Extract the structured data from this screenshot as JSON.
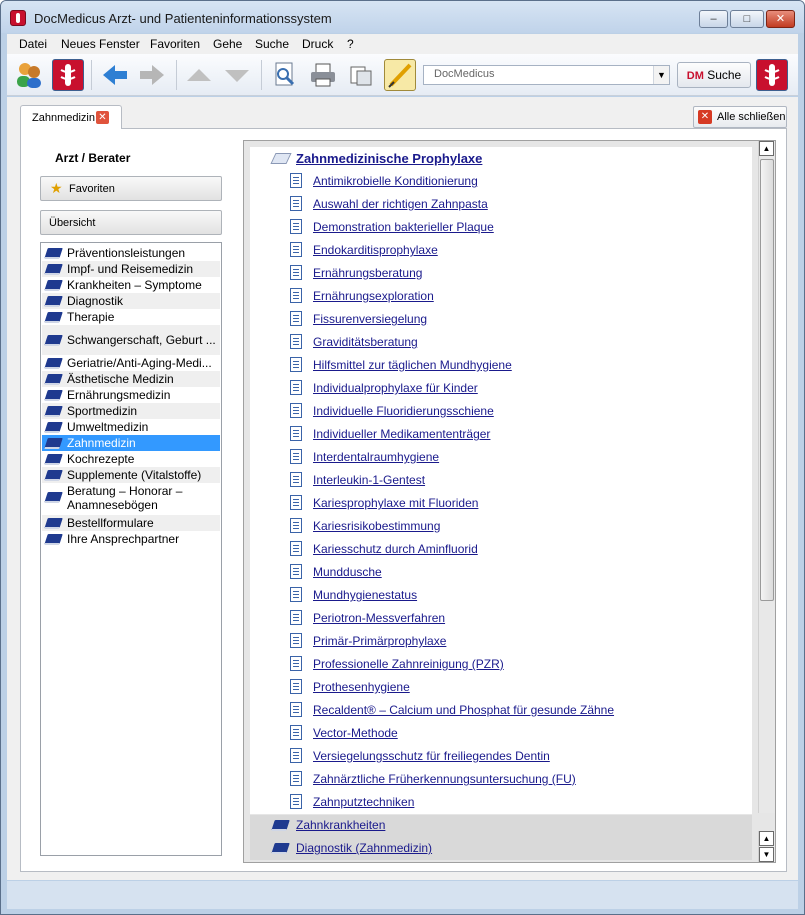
{
  "window": {
    "title": "DocMedicus Arzt- und Patienteninformationssystem"
  },
  "menu": [
    "Datei",
    "Neues Fenster",
    "Favoriten",
    "Gehe",
    "Suche",
    "Druck",
    "?"
  ],
  "toolbar": {
    "combo_value": "DocMedicus",
    "search_prefix": "DM",
    "search_label": "Suche"
  },
  "tabs": {
    "active": "Zahnmedizin",
    "close_all": "Alle schließen"
  },
  "left": {
    "heading": "Arzt / Berater",
    "favoriten": "Favoriten",
    "uebersicht": "Übersicht",
    "items": [
      "Präventionsleistungen",
      "Impf- und Reisemedizin",
      "Krankheiten – Symptome",
      "Diagnostik",
      "Therapie",
      "Schwangerschaft, Geburt ...",
      "Geriatrie/Anti-Aging-Medi...",
      "Ästhetische Medizin",
      "Ernährungsmedizin",
      "Sportmedizin",
      "Umweltmedizin",
      "Zahnmedizin",
      "Kochrezepte",
      "Supplemente (Vitalstoffe)",
      "Beratung – Honorar – Anamnesebögen",
      "Bestellformulare",
      "Ihre Ansprechpartner"
    ]
  },
  "content": {
    "section_title": "Zahnmedizinische Prophylaxe",
    "links": [
      "Antimikrobielle Konditionierung",
      "Auswahl der richtigen Zahnpasta",
      "Demonstration bakterieller Plaque",
      "Endokarditisprophylaxe",
      "Ernährungsberatung",
      "Ernährungsexploration",
      "Fissurenversiegelung",
      "Graviditätsberatung",
      "Hilfsmittel zur täglichen Mundhygiene",
      "Individualprophylaxe für Kinder",
      "Individuelle Fluoridierungsschiene",
      "Individueller Medikamententräger",
      "Interdentalraumhygiene",
      "Interleukin-1-Gentest",
      "Kariesprophylaxe mit Fluoriden",
      "Kariesrisikobestimmung",
      "Kariesschutz durch Aminfluorid",
      "Munddusche",
      "Mundhygienestatus",
      "Periotron-Messverfahren",
      "Primär-Primärprophylaxe",
      "Professionelle Zahnreinigung (PZR)",
      "Prothesenhygiene",
      "Recaldent® – Calcium und Phosphat für gesunde Zähne",
      "Vector-Methode",
      "Versiegelungsschutz für freiliegendes Dentin",
      "Zahnärztliche Früherkennungsuntersuchung (FU)",
      "Zahnputztechniken"
    ],
    "subsections": [
      "Zahnkrankheiten",
      "Diagnostik (Zahnmedizin)"
    ]
  }
}
